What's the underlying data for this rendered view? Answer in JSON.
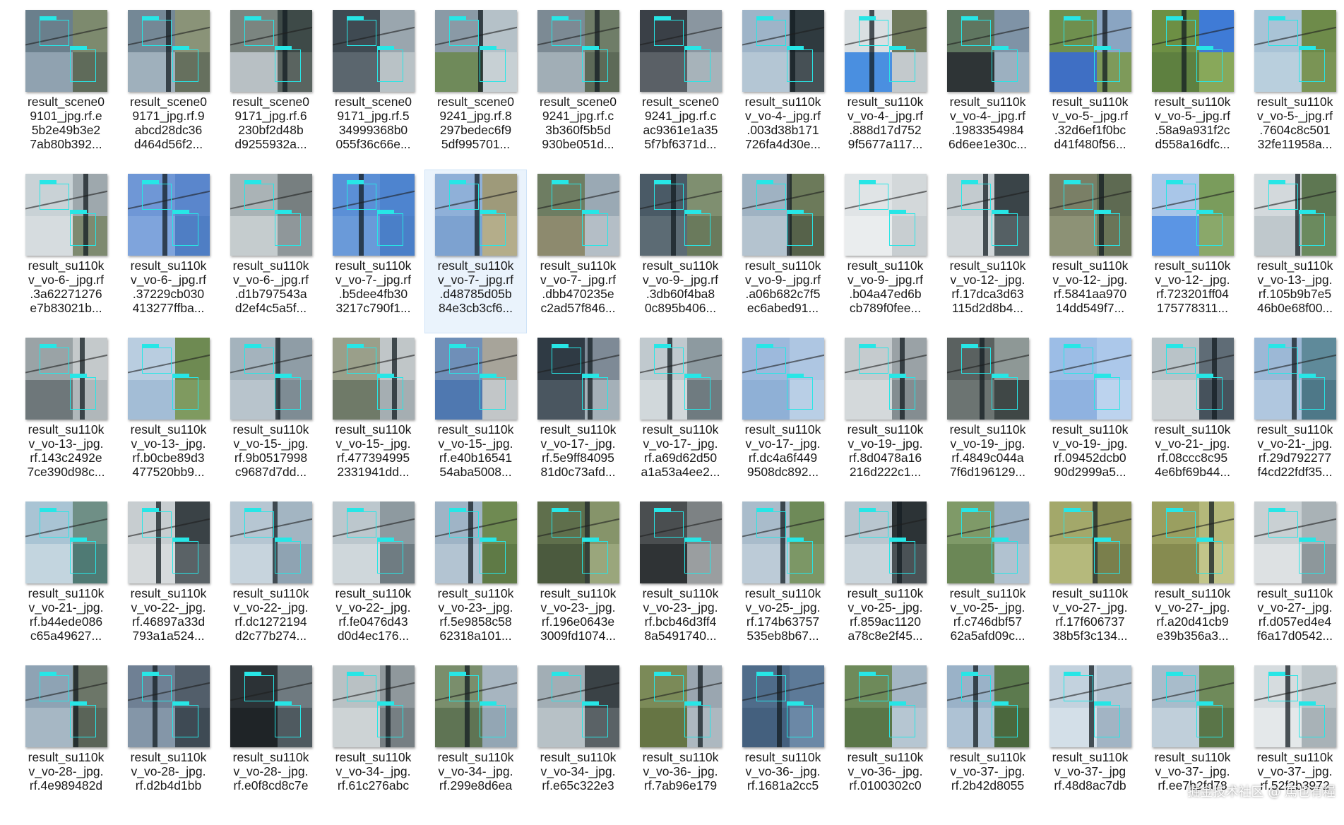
{
  "colors": {
    "background": "#ffffff",
    "selected": "#eaf3fc",
    "detection_box": "#27e6e6"
  },
  "files": [
    {
      "label": "result_scene0\n9101_jpg.rf.e\n5b2e49b3e2\n7ab80b392...",
      "palette": [
        "#6a7f8c",
        "#7d8a6e",
        "#90a2b0",
        "#5f6b5a"
      ]
    },
    {
      "label": "result_scene0\n9171_jpg.rf.9\nabcd28dc36\nd464d56f2...",
      "palette": [
        "#748896",
        "#8a9378",
        "#9fb0bc",
        "#66705e"
      ]
    },
    {
      "label": "result_scene0\n9171_jpg.rf.6\n230bf2d48b\nd9255932a...",
      "palette": [
        "#7b8580",
        "#3e4a48",
        "#b8c0c4",
        "#5a6460"
      ]
    },
    {
      "label": "result_scene0\n9171_jpg.rf.5\n34999368b0\n055f36c66e...",
      "palette": [
        "#3f4a52",
        "#9aa6ae",
        "#5b666e",
        "#b9c2c6"
      ]
    },
    {
      "label": "result_scene0\n9241_jpg.rf.8\n297bedec6f9\n5df995701...",
      "palette": [
        "#8a9aa6",
        "#b5c1c8",
        "#6f8a5a",
        "#c7d0d4"
      ]
    },
    {
      "label": "result_scene0\n9241_jpg.rf.c\n3b360f5b5d\n930be051d...",
      "palette": [
        "#7c8a94",
        "#6f7d68",
        "#a1aeb6",
        "#5d6a58"
      ]
    },
    {
      "label": "result_scene0\n9241_jpg.rf.c\nac9361e1a35\n5f7bf6371d...",
      "palette": [
        "#3a4047",
        "#8a96a0",
        "#5a6066",
        "#a7b3ba"
      ]
    },
    {
      "label": "result_su110k\nv_vo-4-_jpg.rf\n.003d38b171\n726fa4d30e...",
      "palette": [
        "#9eb4c8",
        "#2f3a3f",
        "#b4c6d4",
        "#465055"
      ]
    },
    {
      "label": "result_su110k\nv_vo-4-_jpg.rf\n.888d17d752\n9f5677a117...",
      "palette": [
        "#d9dfe2",
        "#6f7a5c",
        "#4a8fe0",
        "#c3c9cc"
      ]
    },
    {
      "label": "result_su110k\nv_vo-4-_jpg.rf\n.1983354984\n6d6ee1e30c...",
      "palette": [
        "#5f7660",
        "#7f93a6",
        "#2e3436",
        "#9cb0c0"
      ]
    },
    {
      "label": "result_su110k\nv_vo-5-_jpg.rf\n.32d6ef1f0bc\nd41f480f56...",
      "palette": [
        "#6f8f4e",
        "#8aa5c2",
        "#3f6fc4",
        "#7e9a5a"
      ]
    },
    {
      "label": "result_su110k\nv_vo-5-_jpg.rf\n.58a9a931f2c\nd558a16dfc...",
      "palette": [
        "#6d8f44",
        "#3f7bd6",
        "#5e8040",
        "#88a85a"
      ]
    },
    {
      "label": "result_su110k\nv_vo-5-_jpg.rf\n.7604c8c501\n32fe11958a...",
      "palette": [
        "#a9c3d6",
        "#6e8b4a",
        "#b9cfdd",
        "#7a9455"
      ]
    },
    {
      "label": "result_su110k\nv_vo-6-_jpg.rf\n.3a62271276\ne7b83021b...",
      "palette": [
        "#c9d2d6",
        "#9ea8ad",
        "#d6dcdf",
        "#7e8a70"
      ]
    },
    {
      "label": "result_su110k\nv_vo-6-_jpg.rf\n.37229cb030\n413277ffba...",
      "palette": [
        "#6f97d6",
        "#5a86cc",
        "#7fa4dc",
        "#4f7ec4"
      ]
    },
    {
      "label": "result_su110k\nv_vo-6-_jpg.rf\n.d1b797543a\nd2ef4c5a5f...",
      "palette": [
        "#aab3b6",
        "#777f80",
        "#c5ccce",
        "#8f979a"
      ]
    },
    {
      "label": "result_su110k\nv_vo-7-_jpg.rf\n.b5dee4fb30\n3217c790f1...",
      "palette": [
        "#5b8fd6",
        "#4e84cf",
        "#6a9ad9",
        "#4a7fc8"
      ]
    },
    {
      "label": "result_su110k\nv_vo-7-_jpg.rf\n.d48785d05b\n84e3cb3cf6...",
      "palette": [
        "#8fb0d8",
        "#9e9a7a",
        "#7da2d0",
        "#b4ad8a"
      ]
    },
    {
      "label": "result_su110k\nv_vo-7-_jpg.rf\n.dbb470235e\nc2ad57f846...",
      "palette": [
        "#6e7d62",
        "#9aa9b4",
        "#8d8a6e",
        "#b4bec6"
      ]
    },
    {
      "label": "result_su110k\nv_vo-9-_jpg.rf\n.3db60f4ba8\n0c895b406...",
      "palette": [
        "#4a5a66",
        "#7f8f70",
        "#5c6b74",
        "#6a7a5c"
      ]
    },
    {
      "label": "result_su110k\nv_vo-9-_jpg.rf\n.a06b682c7f5\nec6abed91...",
      "palette": [
        "#9fb2c2",
        "#6c7a5a",
        "#b4c3cf",
        "#56624a"
      ]
    },
    {
      "label": "result_su110k\nv_vo-9-_jpg.rf\n.b04a47ed6b\ncb789f0fee...",
      "palette": [
        "#e0e4e6",
        "#d3d8da",
        "#eaedee",
        "#c8ced1"
      ]
    },
    {
      "label": "result_su110k\nv_vo-12-_jpg.\nrf.17dca3d63\n115d2d8b4...",
      "palette": [
        "#c3cbcf",
        "#3a4448",
        "#d0d6d9",
        "#556064"
      ]
    },
    {
      "label": "result_su110k\nv_vo-12-_jpg.\nrf.5841aa970\n14dd549f7...",
      "palette": [
        "#7a7f66",
        "#5e6a52",
        "#8d9276",
        "#6a7558"
      ]
    },
    {
      "label": "result_su110k\nv_vo-12-_jpg.\nrf.723201ff04\n175778311...",
      "palette": [
        "#a9c6e8",
        "#7a9c5c",
        "#5b95e4",
        "#8aa86a"
      ]
    },
    {
      "label": "result_su110k\nv_vo-13-_jpg.\nrf.105b9b7e5\n46b0e68f00...",
      "palette": [
        "#d3d9dc",
        "#5e7752",
        "#bfc8cc",
        "#6b8a5e"
      ]
    },
    {
      "label": "result_su110k\nv_vo-13-_jpg.\nrf.143c2492e\n7ce390d98c...",
      "palette": [
        "#9aa3a6",
        "#c4c9cb",
        "#6e777a",
        "#b0b7ba"
      ]
    },
    {
      "label": "result_su110k\nv_vo-13-_jpg.\nrf.b0cbe89d3\n477520bb9...",
      "palette": [
        "#b9cde0",
        "#6e8a52",
        "#a3bdd6",
        "#7f9a60"
      ]
    },
    {
      "label": "result_su110k\nv_vo-15-_jpg.\nrf.9b0517998\nc9687d7dd...",
      "palette": [
        "#a4b3bd",
        "#8f9da6",
        "#b8c4cc",
        "#7e8c94"
      ]
    },
    {
      "label": "result_su110k\nv_vo-15-_jpg.\nrf.477394995\n2331941dd...",
      "palette": [
        "#9a9f8a",
        "#c0c6c8",
        "#6f7a68",
        "#a5aeb2"
      ]
    },
    {
      "label": "result_su110k\nv_vo-15-_jpg.\nrf.e40b16541\n54aba5008...",
      "palette": [
        "#6f8fb8",
        "#a7a49a",
        "#4f78b0",
        "#c2c6c8"
      ]
    },
    {
      "label": "result_su110k\nv_vo-17-_jpg.\nrf.5e9ff84095\n81d0c73afd...",
      "palette": [
        "#2f3a44",
        "#7e8a96",
        "#4a5660",
        "#a4b0b8"
      ]
    },
    {
      "label": "result_su110k\nv_vo-17-_jpg.\nrf.a69d62d50\na1a53a4ee2...",
      "palette": [
        "#c0c9ce",
        "#8d9aa0",
        "#d1d8db",
        "#6f7b80"
      ]
    },
    {
      "label": "result_su110k\nv_vo-17-_jpg.\nrf.dc4a6f449\n9508dc892...",
      "palette": [
        "#9db9dc",
        "#aec6e2",
        "#8fb0d6",
        "#b9cfe6"
      ]
    },
    {
      "label": "result_su110k\nv_vo-19-_jpg.\nrf.8d0478a16\n216d222c1...",
      "palette": [
        "#c5cbce",
        "#9aa2a6",
        "#d4d9db",
        "#848d91"
      ]
    },
    {
      "label": "result_su110k\nv_vo-19-_jpg.\nrf.4849c044a\n7f6d196129...",
      "palette": [
        "#5a6160",
        "#8e9896",
        "#6c7472",
        "#3f4746"
      ]
    },
    {
      "label": "result_su110k\nv_vo-19-_jpg.\nrf.09452dcb0\n90d2999a5...",
      "palette": [
        "#9cbde6",
        "#acc8ea",
        "#8fb2e0",
        "#bcd3ee"
      ]
    },
    {
      "label": "result_su110k\nv_vo-21-_jpg.\nrf.08ccc8c95\n4e6bf69b44...",
      "palette": [
        "#b9c3c8",
        "#5f6c76",
        "#cdd3d6",
        "#46525c"
      ]
    },
    {
      "label": "result_su110k\nv_vo-21-_jpg.\nrf.29d792277\nf4cd22fdf35...",
      "palette": [
        "#9cb8d6",
        "#5f8a9a",
        "#b0c7df",
        "#4e7888"
      ]
    },
    {
      "label": "result_su110k\nv_vo-21-_jpg.\nrf.b44ede086\nc65a49627...",
      "palette": [
        "#a9c4d4",
        "#6f8f86",
        "#c3d5df",
        "#4f7a74"
      ]
    },
    {
      "label": "result_su110k\nv_vo-22-_jpg.\nrf.46897a33d\n793a1a524...",
      "palette": [
        "#c7cdd0",
        "#3a4246",
        "#d6dadc",
        "#5a6266"
      ]
    },
    {
      "label": "result_su110k\nv_vo-22-_jpg.\nrf.dc1272194\nd2c77b274...",
      "palette": [
        "#b6c6d2",
        "#a3b5c2",
        "#c7d4dd",
        "#8fa3b2"
      ]
    },
    {
      "label": "result_su110k\nv_vo-22-_jpg.\nrf.fe0476d43\nd0d4ec176...",
      "palette": [
        "#bcc7cd",
        "#8e9aa0",
        "#cfd7db",
        "#6f7c82"
      ]
    },
    {
      "label": "result_su110k\nv_vo-23-_jpg.\nrf.5e9858c58\n62318a101...",
      "palette": [
        "#9fb4c6",
        "#6f8a52",
        "#b3c4d2",
        "#5f7a46"
      ]
    },
    {
      "label": "result_su110k\nv_vo-23-_jpg.\nrf.196e0643e\n3009fd1074...",
      "palette": [
        "#5f6f4c",
        "#86946a",
        "#4b5a3e",
        "#9aa67c"
      ]
    },
    {
      "label": "result_su110k\nv_vo-23-_jpg.\nrf.bcb46d3ff4\n8a5491740...",
      "palette": [
        "#4a4e50",
        "#7d8284",
        "#2f3335",
        "#9a9ea0"
      ]
    },
    {
      "label": "result_su110k\nv_vo-25-_jpg.\nrf.174b63757\n535eb8b67...",
      "palette": [
        "#a9bccb",
        "#6e8a58",
        "#bccbd7",
        "#7c9766"
      ]
    },
    {
      "label": "result_su110k\nv_vo-25-_jpg.\nrf.859ac1120\na78c8e2f45...",
      "palette": [
        "#b9c6cf",
        "#2c3336",
        "#c9d4db",
        "#4a5256"
      ]
    },
    {
      "label": "result_su110k\nv_vo-25-_jpg.\nrf.c746dbf57\n62a5afd09c...",
      "palette": [
        "#7f9a68",
        "#9bb0c2",
        "#6b8756",
        "#b1c2d0"
      ]
    },
    {
      "label": "result_su110k\nv_vo-27-_jpg.\nrf.17f606737\n38b5f3c134...",
      "palette": [
        "#a3a86a",
        "#8c9158",
        "#b5b97c",
        "#7a7f4c"
      ]
    },
    {
      "label": "result_su110k\nv_vo-27-_jpg.\nrf.a20d41cb9\ne39b356a3...",
      "palette": [
        "#9a9f60",
        "#b4b87a",
        "#868b50",
        "#c2c58a"
      ]
    },
    {
      "label": "result_su110k\nv_vo-27-_jpg.\nrf.d057ed4e4\nf6a17d0542...",
      "palette": [
        "#c9d0d3",
        "#a9b2b6",
        "#dde1e3",
        "#8d979b"
      ]
    },
    {
      "label": "result_su110k\nv_vo-28-_jpg.\nrf.4e989482d",
      "palette": [
        "#8ea3b4",
        "#6c7668",
        "#a6b7c4",
        "#5a6458"
      ]
    },
    {
      "label": "result_su110k\nv_vo-28-_jpg.\nrf.d2b4d1bb",
      "palette": [
        "#6f8094",
        "#525e6a",
        "#8496a8",
        "#3e4a54"
      ]
    },
    {
      "label": "result_su110k\nv_vo-28-_jpg.\nrf.e0f8cd8c7e",
      "palette": [
        "#2c3236",
        "#6f7a80",
        "#1f2427",
        "#4f5a60"
      ]
    },
    {
      "label": "result_su110k\nv_vo-34-_jpg.\nrf.61c276abc",
      "palette": [
        "#b9c1c4",
        "#8f989c",
        "#cdd3d5",
        "#767f83"
      ]
    },
    {
      "label": "result_su110k\nv_vo-34-_jpg.\nrf.299e8d6ea",
      "palette": [
        "#7a8e6c",
        "#a7b5c0",
        "#5f7454",
        "#93a6b4"
      ]
    },
    {
      "label": "result_su110k\nv_vo-34-_jpg.\nrf.e65c322e3",
      "palette": [
        "#a2aeb5",
        "#3a4246",
        "#b7c1c6",
        "#5a6266"
      ]
    },
    {
      "label": "result_su110k\nv_vo-36-_jpg.\nrf.7ab96e179",
      "palette": [
        "#7b8a58",
        "#9aa6b0",
        "#667544",
        "#adb8c0"
      ]
    },
    {
      "label": "result_su110k\nv_vo-36-_jpg.\nrf.1681a2cc5",
      "palette": [
        "#4f6c8a",
        "#5d7a98",
        "#44607e",
        "#6b88a6"
      ]
    },
    {
      "label": "result_su110k\nv_vo-36-_jpg.\nrf.0100302c0",
      "palette": [
        "#6e8a5a",
        "#a4b6c4",
        "#5a7648",
        "#b6c6d2"
      ]
    },
    {
      "label": "result_su110k\nv_vo-37-_jpg.\nrf.2b42d8055",
      "palette": [
        "#9ab2c8",
        "#5c7a4e",
        "#aec2d4",
        "#4b683e"
      ]
    },
    {
      "label": "result_su110k\nv_vo-37-_jpg\nrf.48d8ac7db",
      "palette": [
        "#c3d2de",
        "#b1c2d0",
        "#d3dfe8",
        "#a2b4c4"
      ]
    },
    {
      "label": "result_su110k\nv_vo-37-_jpg.\nrf.ee7b2fd78",
      "palette": [
        "#a8bccb",
        "#6f8a5a",
        "#c0cfda",
        "#5a7548"
      ]
    },
    {
      "label": "result_su110k\nv_vo-37-_jpg.\nrf.52f2b3972",
      "palette": [
        "#d6dcdf",
        "#bcc5c9",
        "#e4e8ea",
        "#a8b2b7"
      ]
    }
  ],
  "selected_index": 17,
  "watermark": "掘金技术社区 @ 篤也有糧"
}
